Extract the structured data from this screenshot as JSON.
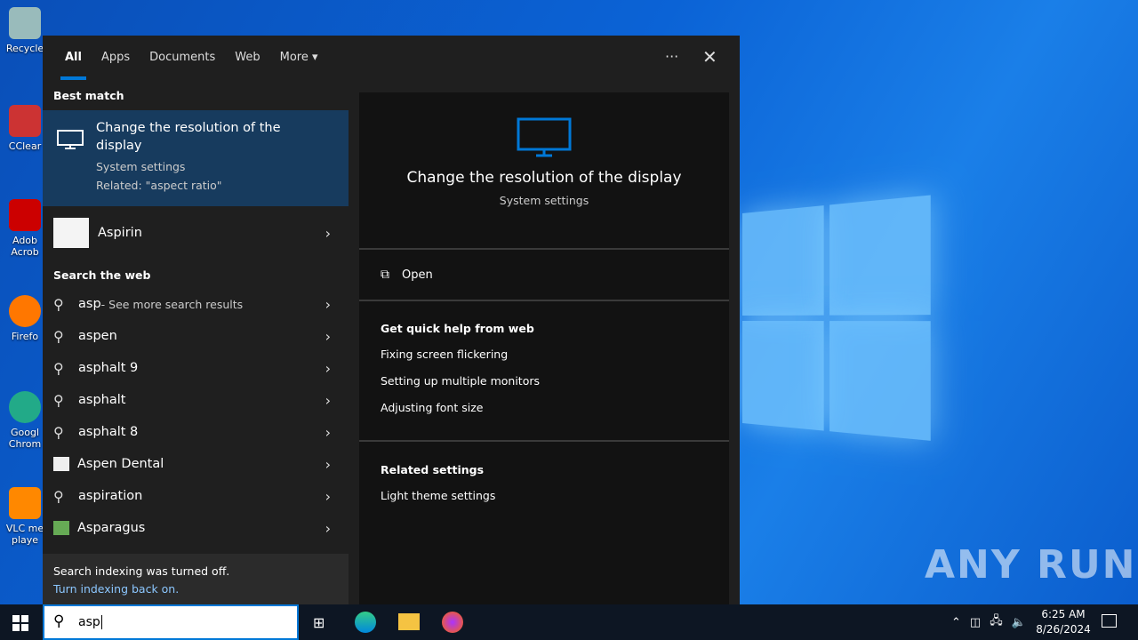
{
  "desktop": {
    "icons": [
      "Recycle",
      "CClear",
      "Adob Acrob",
      "Firefo",
      "Googl Chrom",
      "VLC me playe"
    ]
  },
  "tabs": [
    "All",
    "Apps",
    "Documents",
    "Web",
    "More"
  ],
  "best_match": {
    "section": "Best match",
    "title": "Change the resolution of the display",
    "subtitle": "System settings",
    "related": "Related: \"aspect ratio\""
  },
  "aspirin": "Aspirin",
  "web_section": "Search the web",
  "web_items": [
    {
      "label": "asp",
      "suffix": " - See more search results",
      "icon": "search"
    },
    {
      "label": "aspen",
      "icon": "search"
    },
    {
      "label": "asphalt 9",
      "icon": "search"
    },
    {
      "label": "asphalt",
      "icon": "search"
    },
    {
      "label": "asphalt 8",
      "icon": "search"
    },
    {
      "label": "Aspen Dental",
      "icon": "thumbnail"
    },
    {
      "label": "aspiration",
      "icon": "search"
    },
    {
      "label": "Asparagus",
      "icon": "thumbnail"
    }
  ],
  "footer": {
    "text": "Search indexing was turned off.",
    "link": "Turn indexing back on."
  },
  "preview": {
    "title": "Change the resolution of the display",
    "subtitle": "System settings",
    "open": "Open",
    "help_heading": "Get quick help from web",
    "help_links": [
      "Fixing screen flickering",
      "Setting up multiple monitors",
      "Adjusting font size"
    ],
    "related_heading": "Related settings",
    "related_links": [
      "Light theme settings"
    ]
  },
  "search": {
    "value": "asp"
  },
  "clock": {
    "time": "6:25 AM",
    "date": "8/26/2024"
  },
  "watermark": "ANY RUN",
  "colors": {
    "accent": "#0078d7",
    "selected": "#173b5e"
  }
}
